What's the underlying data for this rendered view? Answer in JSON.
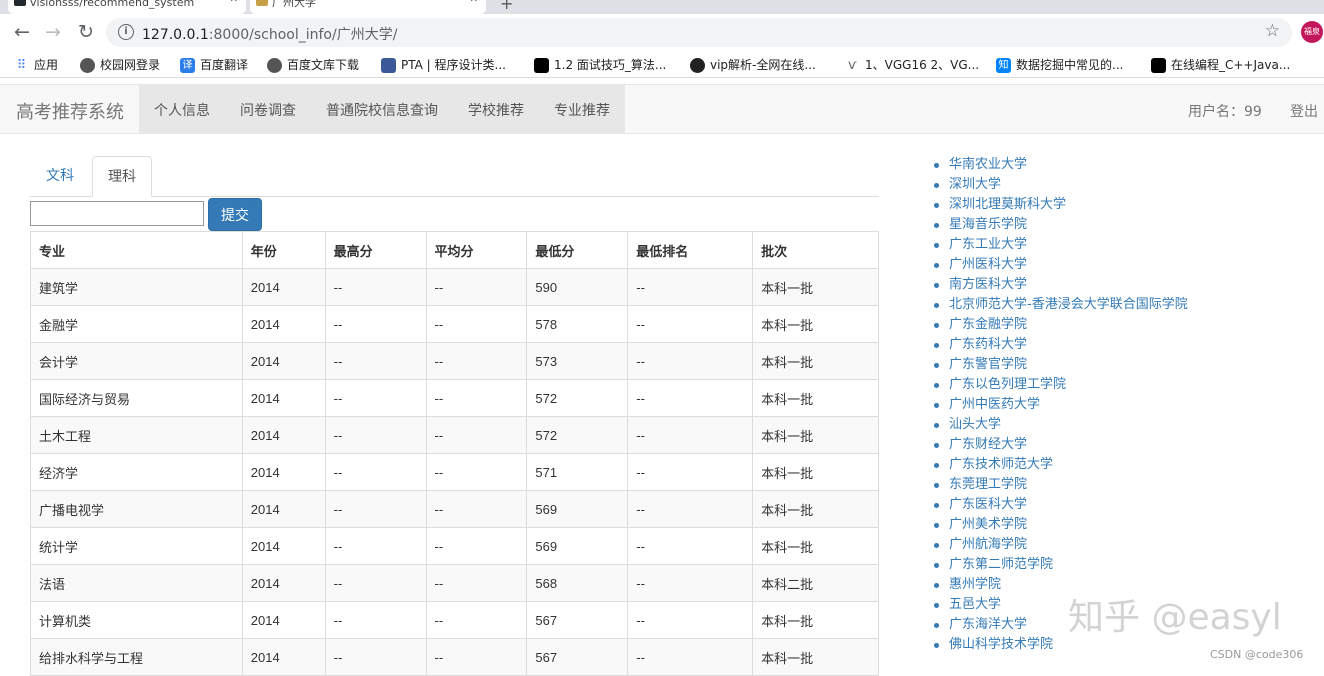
{
  "browser": {
    "tabs": [
      {
        "title": "visionsss/recommend_system",
        "fav_color": "#24292e"
      },
      {
        "title": "广州大学",
        "fav_color": "#c8a04a"
      }
    ],
    "new_tab": "+",
    "url_host": "127.0.0.1",
    "url_path": ":8000/school_info/广州大学/",
    "avatar_text": "福泉",
    "bookmarks": [
      {
        "label": "应用",
        "icon": "apps-icon",
        "color": "#4285f4"
      },
      {
        "label": "校园网登录",
        "icon": "globe-icon",
        "color": "#555"
      },
      {
        "label": "百度翻译",
        "icon": "translate-icon",
        "color": "#2b7de9",
        "glyph": "译"
      },
      {
        "label": "百度文库下载",
        "icon": "globe-icon",
        "color": "#555"
      },
      {
        "label": "PTA | 程序设计类...",
        "icon": "pta-icon",
        "color": "#3b5998"
      },
      {
        "label": "1.2 面试技巧_算法...",
        "icon": "niuke-icon",
        "color": "#000"
      },
      {
        "label": "vip解析-全网在线...",
        "icon": "moon-icon",
        "color": "#222"
      },
      {
        "label": "1、VGG16 2、VG...",
        "icon": "csdn-icon",
        "color": "#666"
      },
      {
        "label": "数据挖掘中常见的...",
        "icon": "zhihu-icon",
        "color": "#0084ff",
        "glyph": "知"
      },
      {
        "label": "在线编程_C++Java...",
        "icon": "niuke-icon",
        "color": "#000"
      }
    ]
  },
  "navbar": {
    "brand": "高考推荐系统",
    "menu": [
      "个人信息",
      "问卷调查",
      "普通院校信息查询",
      "学校推荐",
      "专业推荐"
    ],
    "user": "用户名：99",
    "logout": "登出"
  },
  "tabs": {
    "wenke": "文科",
    "like": "理科"
  },
  "form": {
    "input_value": "",
    "submit": "提交"
  },
  "table": {
    "headers": [
      "专业",
      "年份",
      "最高分",
      "平均分",
      "最低分",
      "最低排名",
      "批次"
    ],
    "rows": [
      [
        "建筑学",
        "2014",
        "--",
        "--",
        "590",
        "--",
        "本科一批"
      ],
      [
        "金融学",
        "2014",
        "--",
        "--",
        "578",
        "--",
        "本科一批"
      ],
      [
        "会计学",
        "2014",
        "--",
        "--",
        "573",
        "--",
        "本科一批"
      ],
      [
        "国际经济与贸易",
        "2014",
        "--",
        "--",
        "572",
        "--",
        "本科一批"
      ],
      [
        "土木工程",
        "2014",
        "--",
        "--",
        "572",
        "--",
        "本科一批"
      ],
      [
        "经济学",
        "2014",
        "--",
        "--",
        "571",
        "--",
        "本科一批"
      ],
      [
        "广播电视学",
        "2014",
        "--",
        "--",
        "569",
        "--",
        "本科一批"
      ],
      [
        "统计学",
        "2014",
        "--",
        "--",
        "569",
        "--",
        "本科一批"
      ],
      [
        "法语",
        "2014",
        "--",
        "--",
        "568",
        "--",
        "本科二批"
      ],
      [
        "计算机类",
        "2014",
        "--",
        "--",
        "567",
        "--",
        "本科一批"
      ],
      [
        "给排水科学与工程",
        "2014",
        "--",
        "--",
        "567",
        "--",
        "本科一批"
      ]
    ]
  },
  "schools": [
    "华南农业大学",
    "深圳大学",
    "深圳北理莫斯科大学",
    "星海音乐学院",
    "广东工业大学",
    "广州医科大学",
    "南方医科大学",
    "北京师范大学-香港浸会大学联合国际学院",
    "广东金融学院",
    "广东药科大学",
    "广东警官学院",
    "广东以色列理工学院",
    "广州中医药大学",
    "汕头大学",
    "广东财经大学",
    "广东技术师范大学",
    "东莞理工学院",
    "广东医科大学",
    "广州美术学院",
    "广州航海学院",
    "广东第二师范学院",
    "惠州学院",
    "五邑大学",
    "广东海洋大学",
    "佛山科学技术学院"
  ],
  "watermark": "知乎 @easyl",
  "csdn": "CSDN @code306"
}
